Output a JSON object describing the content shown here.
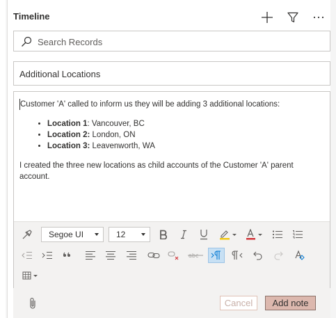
{
  "timeline": {
    "title": "Timeline",
    "icons": [
      "plus-icon",
      "filter-icon",
      "more-icon"
    ]
  },
  "search": {
    "placeholder": "Search Records",
    "value": ""
  },
  "note": {
    "subject": "Additional Locations",
    "intro": "Customer 'A' called to inform us they will be adding 3 additional locations:",
    "locations": [
      {
        "label": "Location 1",
        "sep": ":",
        "value": " Vancouver, BC"
      },
      {
        "label": "Location 2:",
        "sep": "",
        "value": " London, ON"
      },
      {
        "label": "Location 3:",
        "sep": "",
        "value": " Leavenworth, WA"
      }
    ],
    "closing": "I created the three new locations as child accounts of the Customer 'A' parent account."
  },
  "toolbar": {
    "font_family": "Segoe UI",
    "font_size": "12",
    "colors": {
      "highlight": "#f2c811",
      "font_color": "#d13438",
      "active_bg": "#c7e0f4"
    },
    "row1": [
      "format-painter-icon",
      "font-family-select",
      "font-size-select",
      "bold-icon",
      "italic-icon",
      "underline-icon",
      "highlight-icon",
      "font-color-icon",
      "bullet-list-icon",
      "numbered-list-icon"
    ],
    "row2": [
      "decrease-indent-icon",
      "increase-indent-icon",
      "blockquote-icon",
      "align-left-icon",
      "align-center-icon",
      "align-right-icon",
      "link-icon",
      "unlink-icon",
      "strikethrough-icon",
      "ltr-icon",
      "rtl-icon",
      "undo-icon",
      "redo-icon",
      "clear-format-icon"
    ],
    "row3": [
      "table-icon"
    ]
  },
  "footer": {
    "cancel_label": "Cancel",
    "add_label": "Add note",
    "attach_icon": "paperclip-icon"
  }
}
